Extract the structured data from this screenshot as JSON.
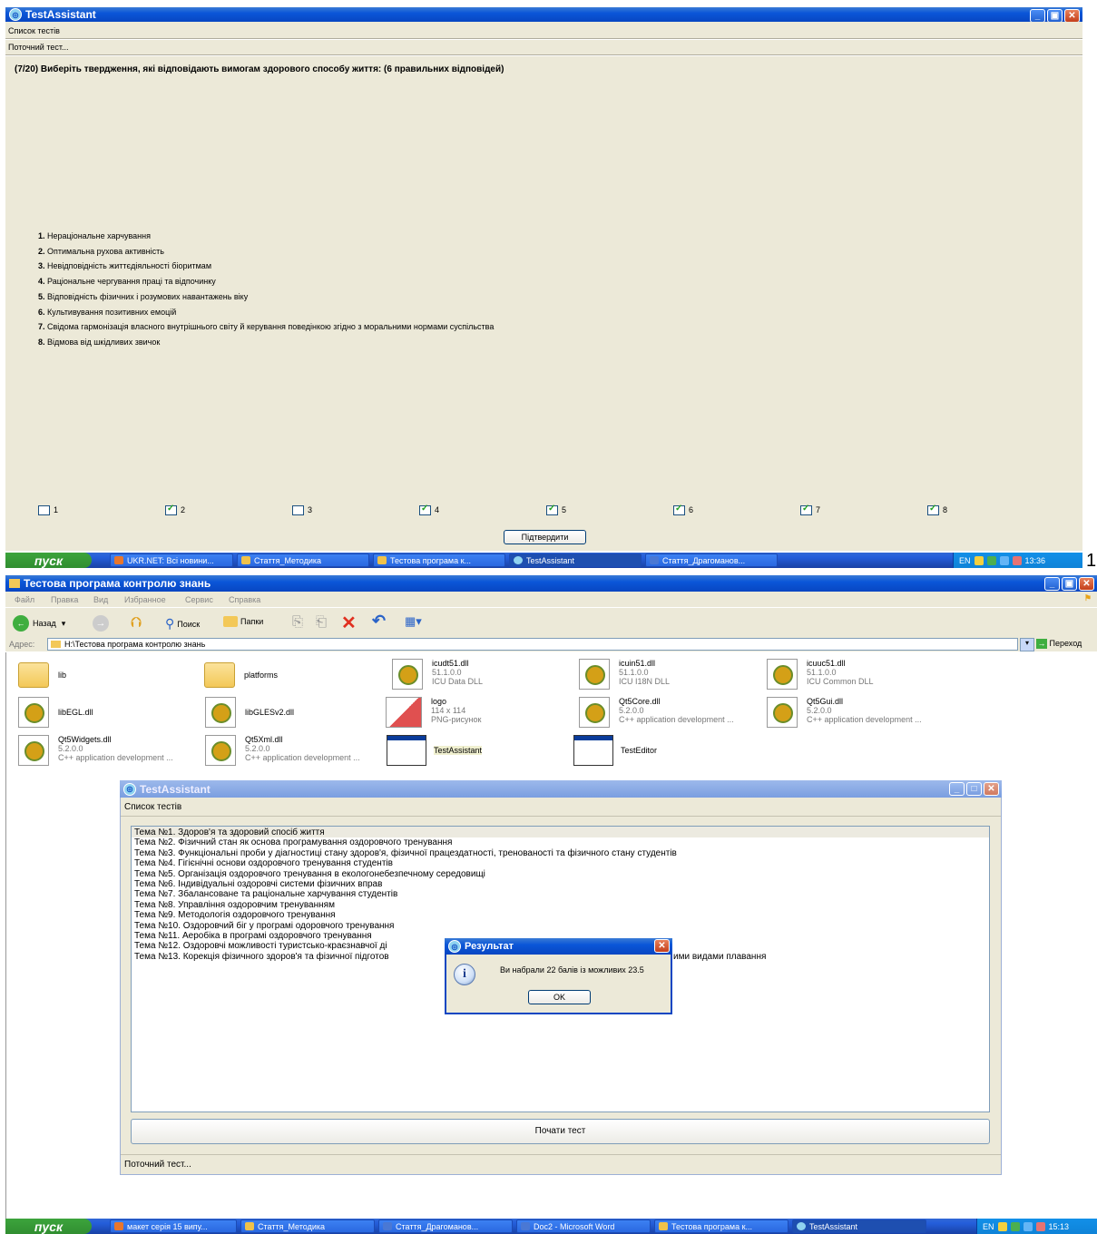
{
  "top_window": {
    "title": "TestAssistant",
    "menu_label": "Список тестів",
    "current_test_label": "Поточний тест...",
    "question": "(7/20) Виберіть твердження, які відповідають вимогам здорового способу життя: (6 правильних відповідей)",
    "answers": [
      {
        "num": "1.",
        "text": "Нераціональне харчування"
      },
      {
        "num": "2.",
        "text": "Оптимальна рухова активність"
      },
      {
        "num": "3.",
        "text": "Невідповідність життєдіяльності біоритмам"
      },
      {
        "num": "4.",
        "text": "Раціональне чергування праці та відпочинку"
      },
      {
        "num": "5.",
        "text": "Відповідність фізичних і розумових навантажень віку"
      },
      {
        "num": "6.",
        "text": "Культивування позитивних емоцій"
      },
      {
        "num": "7.",
        "text": "Свідома гармонізація власного внутрішнього світу й керування поведінкою згідно з моральними нормами суспільства"
      },
      {
        "num": "8.",
        "text": "Відмова від шкідливих звичок"
      }
    ],
    "checkboxes": [
      {
        "label": "1",
        "checked": false
      },
      {
        "label": "2",
        "checked": true
      },
      {
        "label": "3",
        "checked": false
      },
      {
        "label": "4",
        "checked": true
      },
      {
        "label": "5",
        "checked": true
      },
      {
        "label": "6",
        "checked": true
      },
      {
        "label": "7",
        "checked": true
      },
      {
        "label": "8",
        "checked": true
      }
    ],
    "confirm_label": "Підтвердити"
  },
  "taskbar1": {
    "start": "пуск",
    "tasks": [
      "UKR.NET: Всі новини...",
      "Стаття_Методика",
      "Тестова програма к...",
      "TestAssistant",
      "Стаття_Драгоманов..."
    ],
    "tray_lang": "EN",
    "clock": "13:36"
  },
  "figure_number": "1",
  "explorer": {
    "title": "Тестова програма контролю знань",
    "menu": [
      "Файл",
      "Правка",
      "Вид",
      "Избранное",
      "Сервис",
      "Справка"
    ],
    "back": "Назад",
    "search": "Поиск",
    "folders": "Папки",
    "address_label": "Адрес:",
    "address": "H:\\Тестова програма контролю знань",
    "go": "Переход",
    "files": [
      {
        "name": "lib",
        "type": "folder",
        "l1": "",
        "l2": ""
      },
      {
        "name": "platforms",
        "type": "folder",
        "l1": "",
        "l2": ""
      },
      {
        "name": "icudt51.dll",
        "type": "dll",
        "l1": "51.1.0.0",
        "l2": "ICU Data DLL"
      },
      {
        "name": "icuin51.dll",
        "type": "dll",
        "l1": "51.1.0.0",
        "l2": "ICU I18N DLL"
      },
      {
        "name": "icuuc51.dll",
        "type": "dll",
        "l1": "51.1.0.0",
        "l2": "ICU Common DLL"
      },
      {
        "name": "libEGL.dll",
        "type": "dll",
        "l1": "",
        "l2": ""
      },
      {
        "name": "libGLESv2.dll",
        "type": "dll",
        "l1": "",
        "l2": ""
      },
      {
        "name": "logo",
        "type": "png",
        "l1": "114 x 114",
        "l2": "PNG-рисунок"
      },
      {
        "name": "Qt5Core.dll",
        "type": "dll",
        "l1": "5.2.0.0",
        "l2": "C++ application development ..."
      },
      {
        "name": "Qt5Gui.dll",
        "type": "dll",
        "l1": "5.2.0.0",
        "l2": "C++ application development ..."
      },
      {
        "name": "Qt5Widgets.dll",
        "type": "dll",
        "l1": "5.2.0.0",
        "l2": "C++ application development ..."
      },
      {
        "name": "Qt5Xml.dll",
        "type": "dll",
        "l1": "5.2.0.0",
        "l2": "C++ application development ..."
      },
      {
        "name": "TestAssistant",
        "type": "app",
        "l1": "",
        "l2": ""
      },
      {
        "name": "TestEditor",
        "type": "app",
        "l1": "",
        "l2": ""
      }
    ]
  },
  "inner_window": {
    "title": "TestAssistant",
    "menu_label": "Список тестів",
    "topics": [
      "Тема №1. Здоров'я та здоровий спосіб життя",
      "Тема №2. Фізичний стан як основа програмування оздоровчого тренування",
      "Тема №3. Функціональні проби у діагностиці стану здоров'я, фізичної працездатності, тренованості та фізичного стану студентів",
      "Тема №4. Гігієнічні основи оздоровчого тренування студентів",
      "Тема №5. Організація оздоровчого тренування в екологонебезпечному середовищі",
      "Тема №6. Індивідуальні оздоровчі системи фізичних вправ",
      "Тема №7. Збалансоване та раціональне харчування студентів",
      "Тема №8. Управління оздоровчим тренуванням",
      "Тема №9. Методологія оздоровчого тренування",
      "Тема №10. Оздоровчий біг у програмі одоровчого тренування",
      "Тема №11. Аеробіка в програмі оздоровчого тренування",
      "Тема №12. Оздоровчі можливості туристсько-краєзнавчої ді",
      "Тема №13. Корекція фізичного здоров'я та фізичної підготов"
    ],
    "topic13_tail": "ими видами плавання",
    "start_button": "Почати тест",
    "current_test_label": "Поточний тест..."
  },
  "dialog": {
    "title": "Результат",
    "message": "Ви набрали 22 балів із можливих 23.5",
    "ok": "OK"
  },
  "taskbar2": {
    "start": "пуск",
    "tasks": [
      "макет серія 15 випу...",
      "Стаття_Методика",
      "Стаття_Драгоманов...",
      "Doc2 - Microsoft Word",
      "Тестова програма к...",
      "TestAssistant"
    ],
    "tray_lang": "EN",
    "clock": "15:13"
  }
}
